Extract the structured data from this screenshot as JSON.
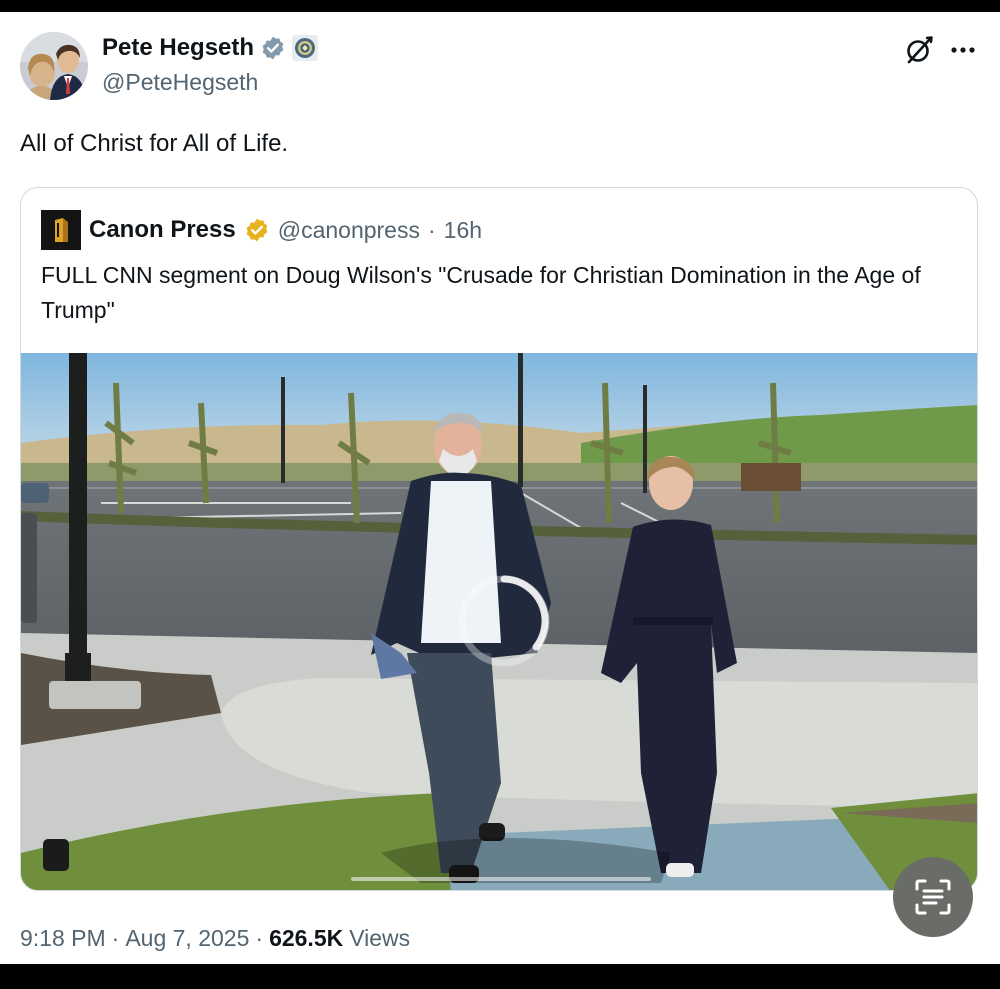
{
  "tweet": {
    "author": {
      "display_name": "Pete Hegseth",
      "handle": "@PeteHegseth",
      "verified_badge": "blue-check-icon",
      "affiliation_badge": "dod-seal-icon"
    },
    "text": "All of Christ for All of Life.",
    "time": "9:18 PM",
    "date": "Aug 7, 2025",
    "sep": "·",
    "views": "626.5K",
    "views_label": "Views"
  },
  "quote": {
    "author": {
      "display_name": "Canon Press",
      "handle": "@canonpress",
      "verified_badge": "gold-check-icon"
    },
    "sep": "·",
    "age": "16h",
    "text": "FULL CNN segment on Doug Wilson's \"Crusade for Christian Domination in the Age of Trump\"",
    "media": {
      "type": "video",
      "loading": true
    }
  },
  "icons": {
    "grok": "grok-icon",
    "more": "more-icon",
    "lens": "google-lens-icon"
  },
  "colors": {
    "text_primary": "#0f1419",
    "text_secondary": "#536471",
    "verified_blue": "#829aab",
    "gold": "#e8b21c",
    "border": "#cfd9de"
  }
}
